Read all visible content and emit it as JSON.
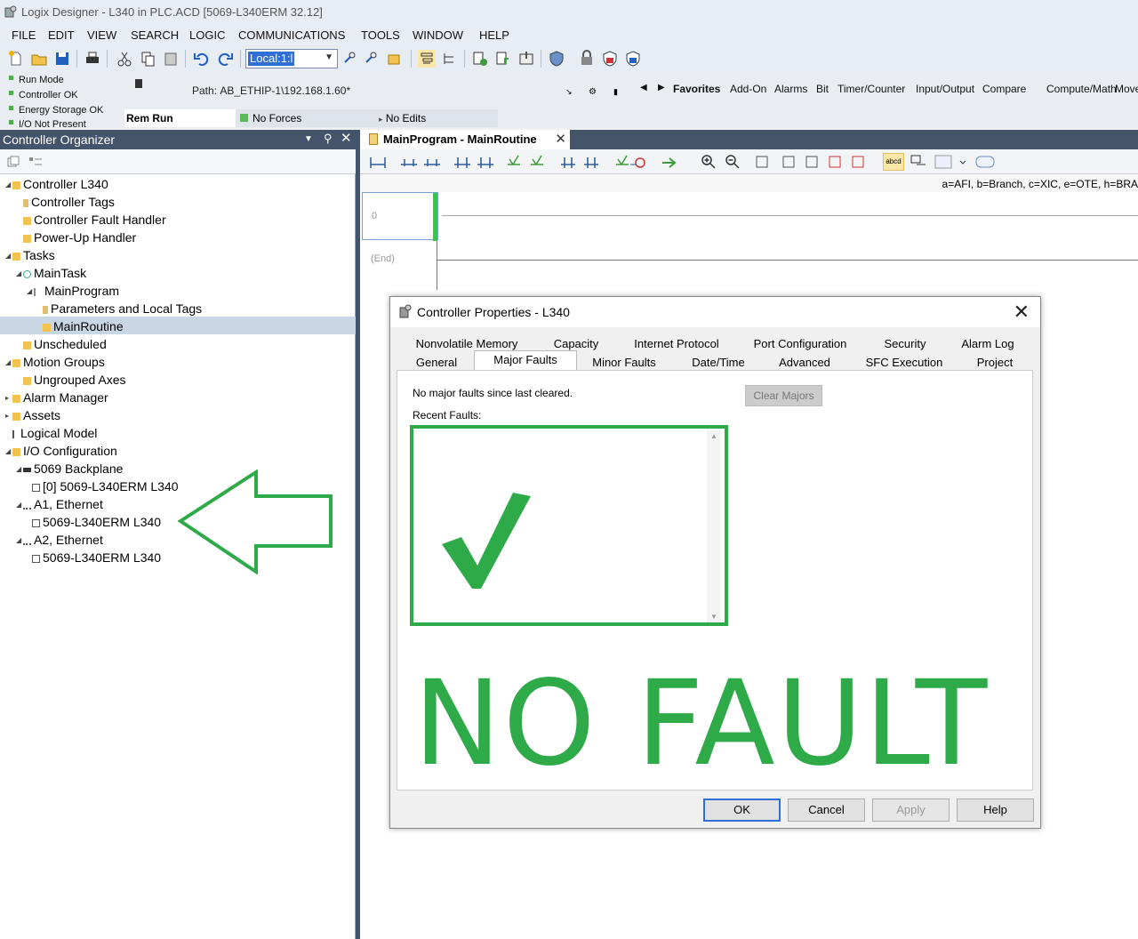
{
  "titlebar": {
    "title": "Logix Designer - L340 in PLC.ACD [5069-L340ERM 32.12]"
  },
  "menu": [
    "FILE",
    "EDIT",
    "VIEW",
    "SEARCH",
    "LOGIC",
    "COMMUNICATIONS",
    "TOOLS",
    "WINDOW",
    "HELP"
  ],
  "toolbar": {
    "path_combo": "Local:1:l"
  },
  "status": {
    "lines": [
      "Run Mode",
      "Controller OK",
      "Energy Storage OK",
      "I/O Not Present"
    ],
    "path_label": "Path:",
    "path_value": "AB_ETHIP-1\\192.168.1.60*",
    "rem_run": "Rem Run",
    "no_forces": "No Forces",
    "no_edits": "No Edits"
  },
  "instruction_tabs": [
    "Favorites",
    "Add-On",
    "Alarms",
    "Bit",
    "Timer/Counter",
    "Input/Output",
    "Compare",
    "Compute/Math",
    "Move"
  ],
  "organizer": {
    "title": "Controller Organizer",
    "tree": [
      "Controller L340",
      "Controller Tags",
      "Controller Fault Handler",
      "Power-Up Handler",
      "Tasks",
      "MainTask",
      "MainProgram",
      "Parameters and Local Tags",
      "MainRoutine",
      "Unscheduled",
      "Motion Groups",
      "Ungrouped Axes",
      "Alarm Manager",
      "Assets",
      "Logical Model",
      "I/O Configuration",
      "5069 Backplane",
      "[0] 5069-L340ERM L340",
      "A1, Ethernet",
      "5069-L340ERM L340",
      "A2, Ethernet",
      "5069-L340ERM L340"
    ]
  },
  "editor": {
    "tab_title": "MainProgram - MainRoutine",
    "hint": "a=AFI, b=Branch, c=XIC, e=OTE, h=BRA",
    "rung_number": "0",
    "end_label": "(End)"
  },
  "dialog": {
    "title": "Controller Properties - L340",
    "tabs_row1": [
      "Nonvolatile Memory",
      "Capacity",
      "Internet Protocol",
      "Port Configuration",
      "Security",
      "Alarm Log"
    ],
    "tabs_row2": [
      "General",
      "Major Faults",
      "Minor Faults",
      "Date/Time",
      "Advanced",
      "SFC Execution",
      "Project"
    ],
    "active_tab": "Major Faults",
    "no_major_text": "No major faults since last cleared.",
    "recent_faults_label": "Recent Faults:",
    "clear_majors": "Clear Majors",
    "overlay_text": "NO FAULT",
    "buttons": {
      "ok": "OK",
      "cancel": "Cancel",
      "apply": "Apply",
      "help": "Help"
    }
  },
  "colors": {
    "overlay_green": "#2eab48",
    "header_bg": "#44546a",
    "selection": "#c9d6e6"
  }
}
